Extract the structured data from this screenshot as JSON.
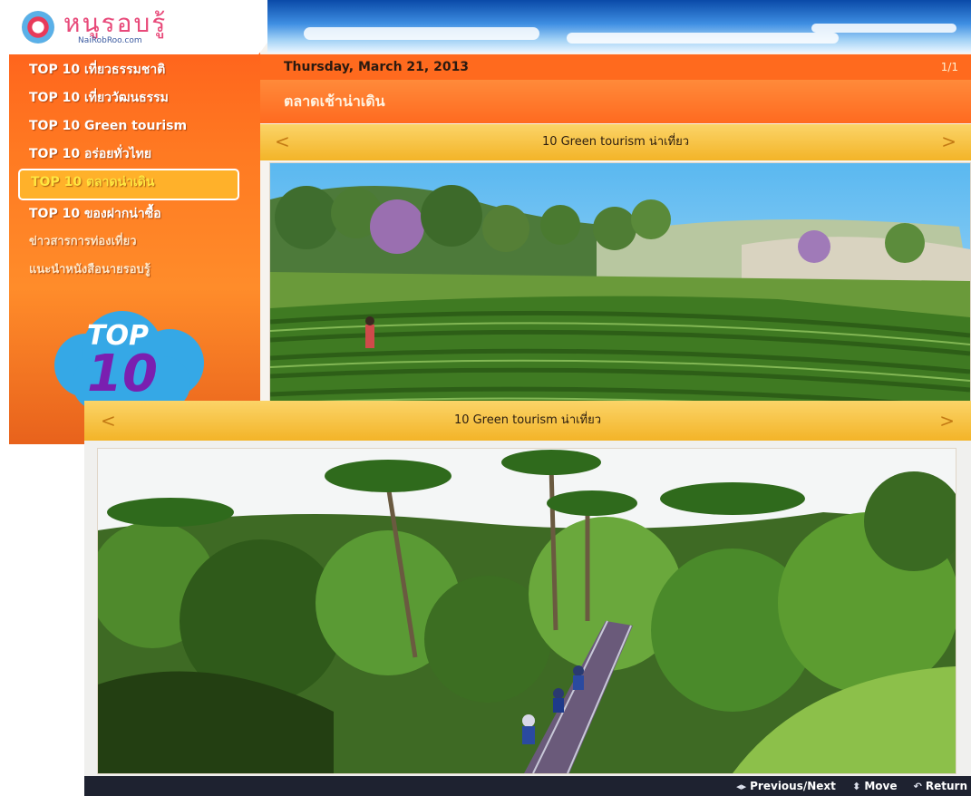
{
  "logo": {
    "script": "หนูรอบรู้",
    "url": "NaiRobRoo.com"
  },
  "sidebar": {
    "items": [
      {
        "label": "TOP 10 เที่ยวธรรมชาติ"
      },
      {
        "label": "TOP 10 เที่ยววัฒนธรรม"
      },
      {
        "label": "TOP 10 Green tourism"
      },
      {
        "label": "TOP 10 อร่อยทั่วไทย"
      },
      {
        "label": "TOP 10 ตลาดน่าเดิน"
      },
      {
        "label": "TOP 10 ของฝากน่าซื้อ"
      },
      {
        "label": "ข่าวสารการท่องเที่ยว"
      },
      {
        "label": "แนะนำหนังสือนายรอบรู้"
      }
    ],
    "badge_line1": "TOP",
    "badge_line2": "10"
  },
  "header": {
    "date": "Thursday, March 21, 2013",
    "page": "1/1",
    "title": "ตลาดเช้าน่าเดิน"
  },
  "gallery_top": {
    "caption": "10 Green tourism น่าเที่ยว",
    "prev": "<",
    "next": ">"
  },
  "gallery_bottom": {
    "caption": "10 Green tourism น่าเที่ยว",
    "prev": "<",
    "next": ">"
  },
  "footer": {
    "prev_next_icon": "◂▸",
    "prev_next": "Previous/Next",
    "move_icon": "⬍",
    "move": "Move",
    "return_icon": "↶",
    "return": "Return"
  },
  "colors": {
    "sidebar": "#ff6a1e",
    "caption": "#f3b428",
    "accent_purple": "#7a1fb0",
    "bar": "#1e2230"
  }
}
